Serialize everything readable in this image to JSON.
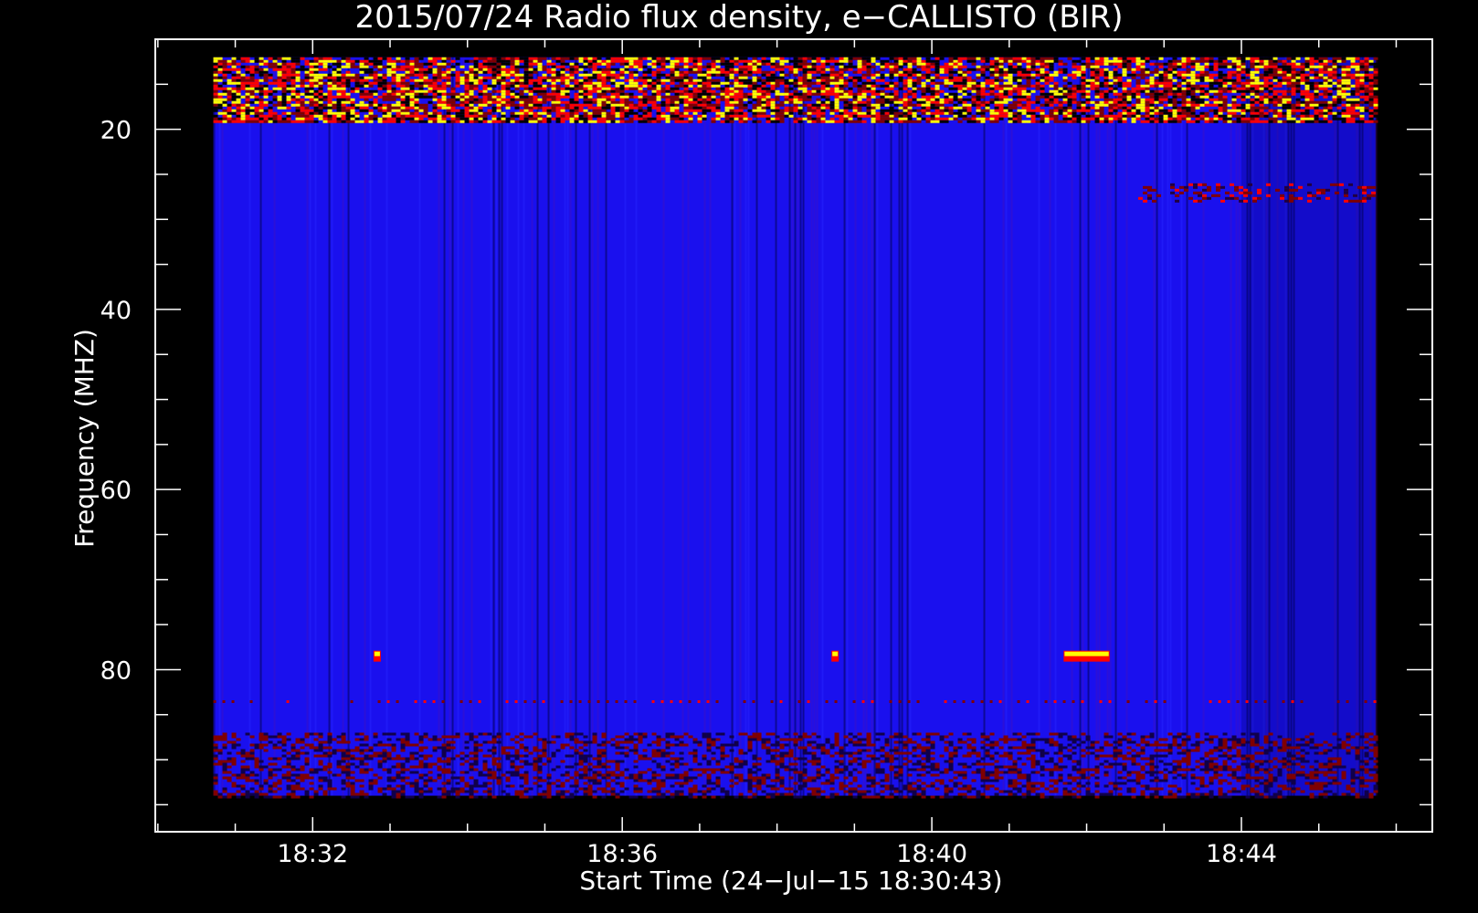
{
  "chart_data": {
    "type": "heatmap",
    "title": "2015/07/24  Radio flux density, e−CALLISTO (BIR)",
    "xlabel": "Start Time (24−Jul−15 18:30:43)",
    "ylabel": "Frequency (MHZ)",
    "xlim": [
      "18:29:58",
      "18:46:28"
    ],
    "ylim": [
      10,
      98
    ],
    "y_inverted": true,
    "data_x_range": [
      "18:30:43",
      "18:45:44"
    ],
    "data_y_range": [
      12,
      94
    ],
    "x_ticks": [
      "18:32",
      "18:36",
      "18:40",
      "18:44"
    ],
    "y_ticks": [
      20,
      40,
      60,
      80
    ],
    "colormap": [
      "#000000",
      "#0000ff",
      "#7f0000",
      "#ff0000",
      "#ffff00"
    ],
    "background_level": "#1a10ee",
    "features": [
      {
        "kind": "interference-band",
        "freq_range": [
          12,
          19
        ],
        "time_range": [
          "18:30:43",
          "18:45:44"
        ],
        "intensity": "high"
      },
      {
        "kind": "interference-band",
        "freq_range": [
          26,
          28
        ],
        "time_range": [
          "18:42:40",
          "18:45:44"
        ],
        "intensity": "medium"
      },
      {
        "kind": "dashed-line",
        "freq": 83.5,
        "time_range": [
          "18:30:43",
          "18:45:44"
        ],
        "intensity": "medium"
      },
      {
        "kind": "noisy-band",
        "freq_range": [
          87,
          94
        ],
        "time_range": [
          "18:30:43",
          "18:45:44"
        ],
        "intensity": "low"
      },
      {
        "kind": "spike",
        "freq": 78.5,
        "time": "18:32:50",
        "intensity": "high"
      },
      {
        "kind": "spike",
        "freq": 78.5,
        "time": "18:38:45",
        "intensity": "high"
      },
      {
        "kind": "spike",
        "freq": 78.5,
        "time": [
          "18:41:45",
          "18:42:15"
        ],
        "intensity": "high"
      }
    ]
  }
}
